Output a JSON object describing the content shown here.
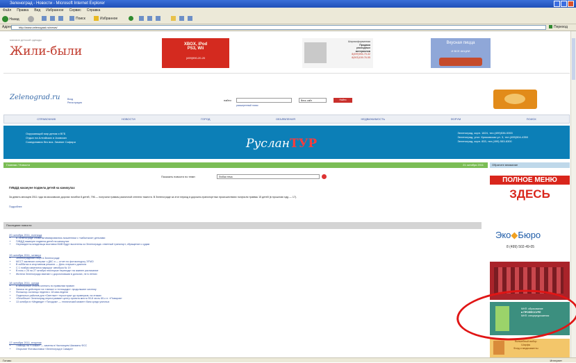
{
  "window": {
    "title": "Зеленоград - Новости - Microsoft Internet Explorer"
  },
  "menu": [
    "Файл",
    "Правка",
    "Вид",
    "Избранное",
    "Сервис",
    "Справка"
  ],
  "toolbar": {
    "back": "Назад",
    "search": "Поиск",
    "favorites": "Избранное"
  },
  "address": {
    "label": "Адрес",
    "url": "http://www.zelenograd.ru/news/",
    "go": "Переход",
    "links": "Ссылки"
  },
  "header": {
    "site_logo": "Жили-были",
    "site_logo_tagline": "магазин детской одежды",
    "ad_xbox": {
      "line1": "XBOX, iPod",
      "line2": "PS3, Wii",
      "phone": "(499)990-20-20"
    },
    "ad_printing": {
      "lines": [
        "Широкоформатная",
        "Продажа",
        "расходных",
        "материалов"
      ],
      "phone1": "8(499)994-79-32",
      "phone2": "8(903)159-76-55"
    },
    "ad_food": {
      "title": "Вкусная пицца",
      "subtitle": "И ВСЕ АКЦИИ"
    }
  },
  "site": {
    "logo": "Zelenograd.ru",
    "links": [
      "Вход",
      "Регистрация"
    ],
    "search_label": "найти",
    "search_hint": "расширенный поиск",
    "search_select": "Весь сайт",
    "search_button": "Найти"
  },
  "nav": [
    "СПРАВОЧНИК",
    "НОВОСТИ",
    "ГОРОД",
    "ОБЪЯВЛЕНИЯ",
    "НЕДВИЖИМОСТЬ",
    "ФОРУМ",
    "ПОИСК"
  ],
  "banner": {
    "left_lines": [
      "Окружающий мир детям и ВГБ",
      "Отдых на Алтайских и Азовских",
      "Скандинавия без виз. Зимние Сафари"
    ],
    "logo_main": "Руслан",
    "logo_accent": "ТУР",
    "right_lines": [
      "Зеленоград, корп. 1824, тел.(499)536-5353",
      "Зеленоград, угол. Крюковская ул. 3, тел.(495)504-4350",
      "Зеленоград, корп. 833, тел.(499) 553-6300"
    ]
  },
  "main": {
    "breadcrumb": "Главная / Новости",
    "date": "21 октября 2011",
    "right_header": "Обратите внимание",
    "category_label": "Показать новости по теме:",
    "category_value": "Любая тема",
    "lead_title": "ГИБДД накануне подвела детей на каникулах",
    "lead_text": "За девять месяцев 2011 года на московских дорогах погибли 8 детей, 796 — получили травмы различной степени тяжести. В Зеленограде за этот период в дорожно-транспортных происшествиях получили травмы 15 детей (в прошлом году — 17).",
    "lead_more": "Подробнее",
    "section_title": "Последние новости",
    "groups": [
      {
        "date": "20 октября 2011, пятница",
        "items": [
          "В Зеленограде снова активизировались мошенники с «забытыми» деньгами",
          "ГИБДД накануне подвела детей на каникулах",
          "Нерезиденты-владельцы выставок МАВ будут выселены из Зеленограда: ответный транспорт, обращение к судам"
        ]
      },
      {
        "date": "19 октября 2011, четверг",
        "items": [
          "Зеленоградский спорт в Зеленограде",
          "МССТ заключил контракт с ДКС и — отчет по фотоконкурсу ЭТМО",
          "В хоббитах в спортивном решили — День старшего диалога",
          "С 1 ноября изменится маршрут автобуса № 19",
          "В ночь с 26 на 27 октября некоторые переходят на зимнее расписание",
          "Жители Зеленограда хватают с дорогоновыми в дольних, не в летних"
        ]
      },
      {
        "date": "18 октября 2011, среда",
        "items": [
          "В электричке стоили клепать по правилам правил",
          "Записи не действуют на «линии» и «площади»: продолжают систему",
          "Фольклор-гостинцы неделю с 18 мая-недели",
          "Отдельных районов для «Светлые» «просторы» до правнуков, на этажах",
          "«Лечебные» Зеленоград перестраивает центр проекта мести 90-й честь 60-х гг. «Поваров»",
          "13 октября в «Медведи» «Тиходом» — технический момент банк среди уличных"
        ]
      },
      {
        "date": "17 октября 2011, вторник",
        "items": [
          "Помощь на «Точках» — замены в Настоящем Шахматы ФСС",
          "Открытие Фотовыставки «Зеленоград в Самаре»"
        ]
      }
    ]
  },
  "sidebar": {
    "menu_ad": {
      "line1": "ПОЛНОЕ МЕНЮ",
      "line2": "ЗДЕСЬ"
    },
    "eco": {
      "name_left": "Эко",
      "name_right": "Бюро",
      "phone": "8 (499) 502-49-05"
    },
    "edu": {
      "line1": "МНП: образование",
      "line2": "в ПРОФЕССУРЕ",
      "line3": "МНП: спецпредложения"
    },
    "bottom": {
      "line1": "Волшебный выбор",
      "line2": "Шарфы",
      "line3": "Фонд и медикаменты"
    }
  },
  "status": {
    "text": "Готово",
    "zone": "Интернет"
  },
  "colors": {
    "accent_blue": "#0c7fb7",
    "green_bar": "#7bbd55",
    "red": "#e01515"
  }
}
